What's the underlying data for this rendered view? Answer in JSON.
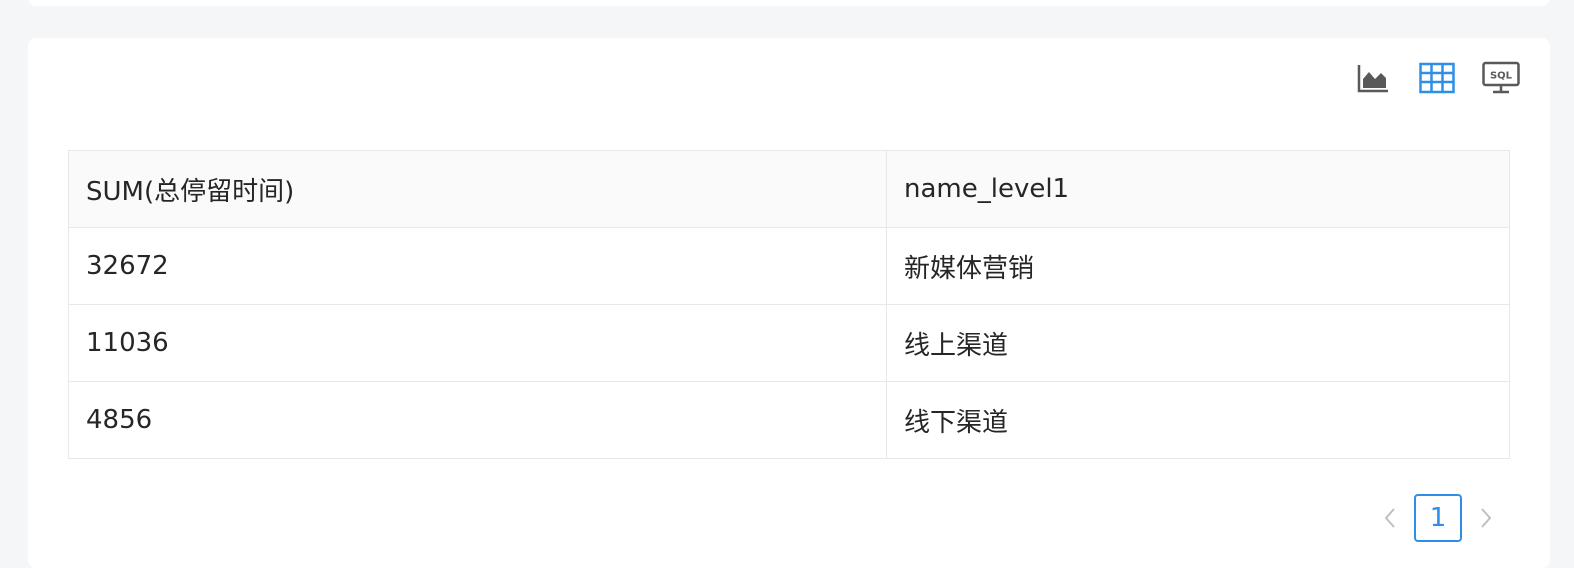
{
  "toolbar": {
    "icons": [
      "area-chart-icon",
      "table-icon",
      "sql-icon"
    ],
    "active": "table-icon",
    "sql_label": "SQL",
    "active_color": "#2f8fe6",
    "inactive_color": "#595959"
  },
  "table": {
    "columns": [
      "SUM(总停留时间)",
      "name_level1"
    ],
    "rows": [
      [
        "32672",
        "新媒体营销"
      ],
      [
        "11036",
        "线上渠道"
      ],
      [
        "4856",
        "线下渠道"
      ]
    ]
  },
  "pagination": {
    "prev_label": "<",
    "current_page": "1",
    "next_label": ">"
  }
}
